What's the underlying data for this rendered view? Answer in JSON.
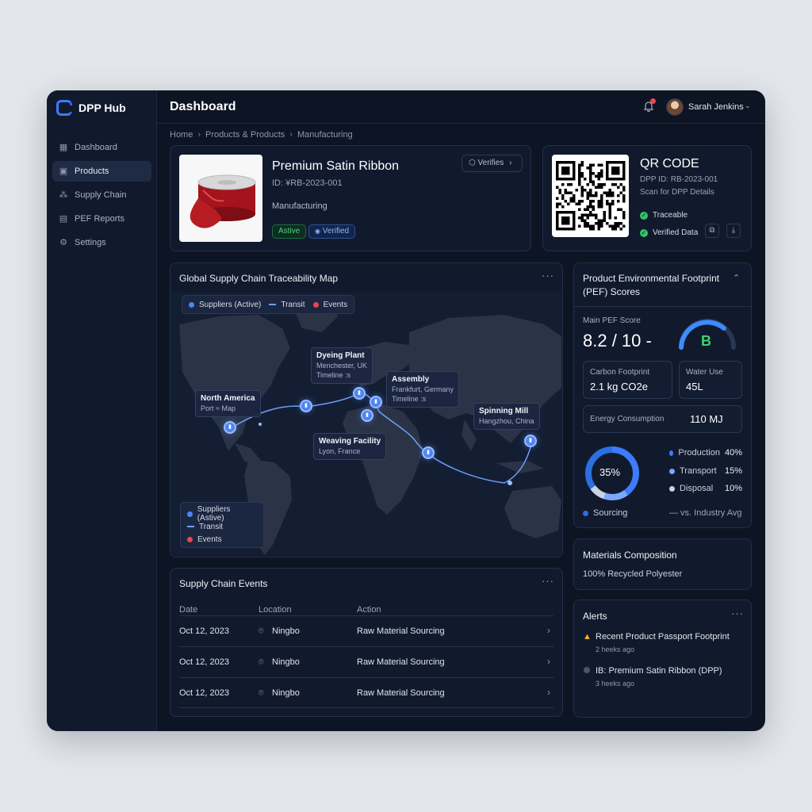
{
  "app": {
    "name": "DPP Hub"
  },
  "sidebar": {
    "items": [
      {
        "label": "Dashboard",
        "icon": "grid-icon"
      },
      {
        "label": "Products",
        "icon": "box-icon"
      },
      {
        "label": "Supply Chain",
        "icon": "network-icon"
      },
      {
        "label": "PEF Reports",
        "icon": "document-icon"
      },
      {
        "label": "Settings",
        "icon": "gear-icon"
      }
    ]
  },
  "header": {
    "title": "Dashboard",
    "user": "Sarah Jenkins"
  },
  "breadcrumb": [
    "Home",
    "Products & Products",
    "Manufacturing"
  ],
  "product": {
    "name": "Premium Satin Ribbon",
    "id": "ID: ¥RB-2023-001",
    "stage": "Manufacturing",
    "badge_active": "Astive",
    "badge_verified": "Verified",
    "verify_button": "Verifies"
  },
  "qr": {
    "title": "QR CODE",
    "id": "DPP ID: RB-2023-001",
    "scan": "Scan for DPP Details",
    "traceable": "Traceable",
    "verified": "Verified Data"
  },
  "map": {
    "title": "Global Supply Chain Traceability Map",
    "legend": {
      "suppliers": "Suppliers (Active)",
      "transit": "Transit",
      "events": "Events"
    },
    "legend_bottom": {
      "suppliers": "Suppliers (Astive)",
      "transit": "Transit",
      "events": "Events"
    },
    "callouts": [
      {
        "title": "North America",
        "sub": "Port ≈ Map"
      },
      {
        "title": "Dyeing Plant",
        "sub": "Menchester, UK",
        "extra": "Timeline :s"
      },
      {
        "title": "Assembly",
        "sub": "Frankfurt, Germany",
        "extra": "Timeline :s"
      },
      {
        "title": "Spinning Mill",
        "sub": "Hangzhou, China"
      },
      {
        "title": "Weaving Facility",
        "sub": "Lyon, France"
      }
    ],
    "colors": {
      "supplier": "#4d86f2",
      "transit": "#6fa0ff",
      "event": "#e5484d"
    }
  },
  "events": {
    "title": "Supply Chain Events",
    "columns": [
      "Date",
      "Location",
      "Action"
    ],
    "rows": [
      {
        "date": "Oct 12, 2023",
        "location": "Ningbo",
        "action": "Raw Material Sourcing"
      },
      {
        "date": "Oct 12, 2023",
        "location": "Ningbo",
        "action": "Raw Material Sourcing"
      },
      {
        "date": "Oct 12, 2023",
        "location": "Ningbo",
        "action": "Raw Material Sourcing"
      }
    ]
  },
  "pef": {
    "title": "Product Environmental Footprint (PEF) Scores",
    "main_label": "Main PEF Score",
    "main_value": "8.2 / 10 -",
    "grade": "B",
    "carbon_label": "Carbon Footprint",
    "carbon_value": "2.1 kg CO2e",
    "water_label": "Water Use",
    "water_value": "45L",
    "energy_label": "Energy Consumption",
    "energy_value": "110 MJ",
    "donut_center": "35%",
    "breakdown": [
      {
        "label": "Production",
        "value": "40%",
        "color": "#3d7bff"
      },
      {
        "label": "Transport",
        "value": "15%",
        "color": "#7aa7ff"
      },
      {
        "label": "Disposal",
        "value": "10%",
        "color": "#c9d3e6"
      }
    ],
    "sourcing_label": "Sourcing",
    "industry_label": "— vs. Industry Avg"
  },
  "materials": {
    "title": "Materials Composition",
    "value": "100% Recycled Polyester"
  },
  "alerts": {
    "title": "Alerts",
    "items": [
      {
        "title": "Recent Product Passport Footprint",
        "time": "2 heeks ago"
      },
      {
        "title": "IB: Premium Satin Ribbon (DPP)",
        "time": "3 heeks ago"
      }
    ]
  }
}
